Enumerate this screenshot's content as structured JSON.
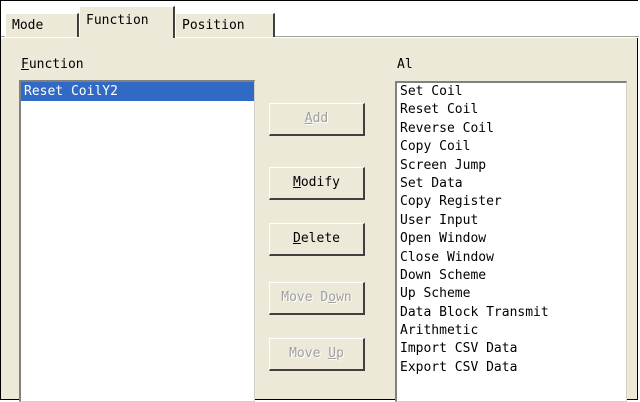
{
  "tabs": [
    {
      "label": "Mode",
      "active": false
    },
    {
      "label": "Function",
      "active": true
    },
    {
      "label": "Position",
      "active": false
    }
  ],
  "function_panel": {
    "label_mnemonic": "F",
    "label_rest": "unction",
    "items": [
      "Reset CoilY2"
    ],
    "selected_index": 0
  },
  "all_panel": {
    "label": "Al",
    "items": [
      "Set Coil",
      "Reset Coil",
      "Reverse Coil",
      "Copy Coil",
      "Screen Jump",
      "Set Data",
      "Copy Register",
      "User Input",
      "Open Window",
      "Close Window",
      "Down Scheme",
      "Up Scheme",
      "Data Block Transmit",
      "Arithmetic",
      "Import CSV Data",
      "Export CSV Data"
    ]
  },
  "buttons": {
    "add": {
      "pre": "",
      "mnemonic": "A",
      "post": "dd",
      "enabled": false
    },
    "modify": {
      "pre": "",
      "mnemonic": "M",
      "post": "odify",
      "enabled": true
    },
    "delete": {
      "pre": "",
      "mnemonic": "D",
      "post": "elete",
      "enabled": true
    },
    "move_down": {
      "pre": "Move D",
      "mnemonic": "o",
      "post": "wn",
      "enabled": false
    },
    "move_up": {
      "pre": "Move ",
      "mnemonic": "U",
      "post": "p",
      "enabled": false
    }
  },
  "colors": {
    "dialog_bg": "#ece9d8",
    "selection": "#316ac5",
    "disabled_text": "#a0a0a0"
  }
}
